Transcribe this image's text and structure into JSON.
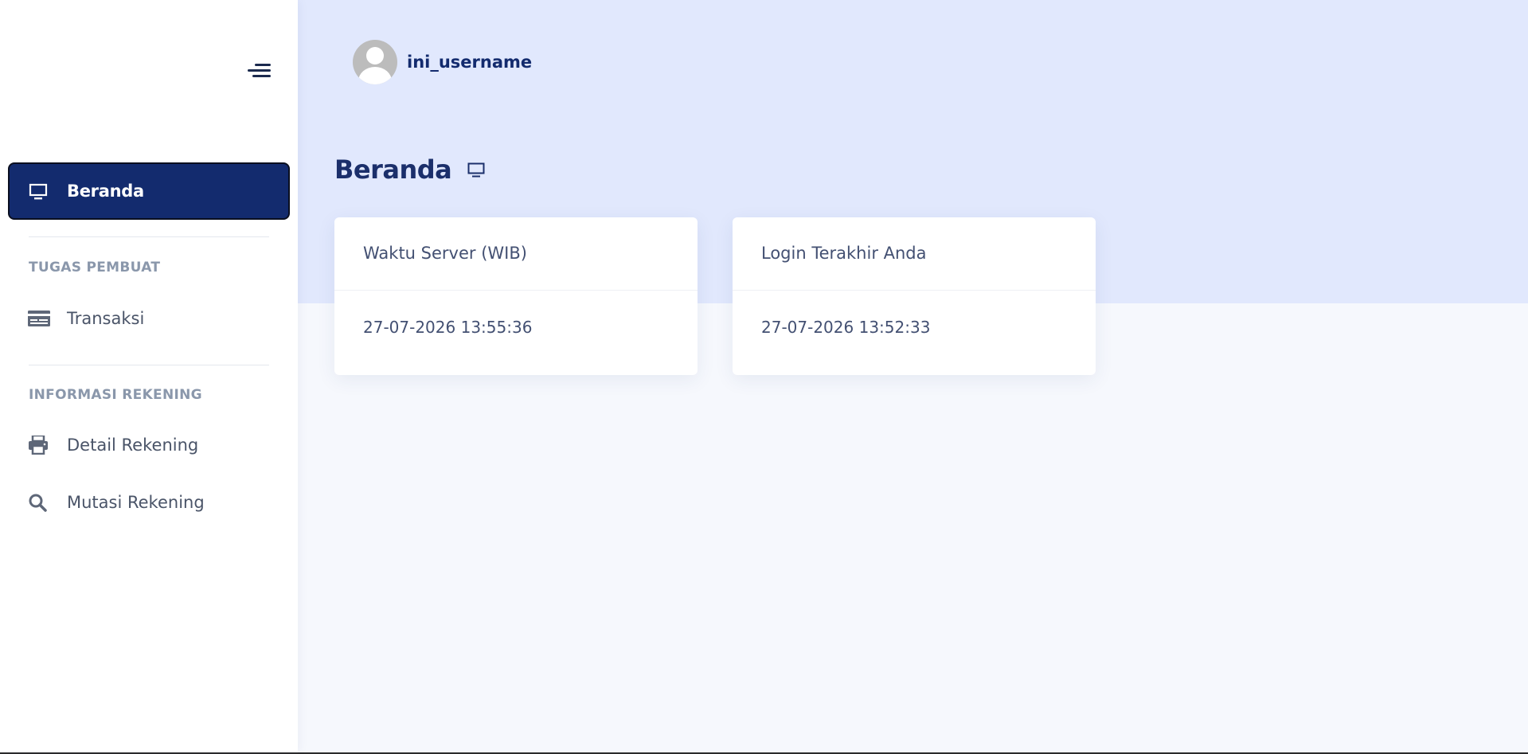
{
  "sidebar": {
    "toggle_icon": "hamburger-menu-icon",
    "active_item": {
      "label": "Beranda",
      "icon": "monitor-icon"
    },
    "sections": [
      {
        "title": "TUGAS PEMBUAT",
        "items": [
          {
            "label": "Transaksi",
            "icon": "credit-card-icon"
          }
        ]
      },
      {
        "title": "INFORMASI REKENING",
        "items": [
          {
            "label": "Detail Rekening",
            "icon": "printer-icon"
          },
          {
            "label": "Mutasi Rekening",
            "icon": "search-icon"
          }
        ]
      }
    ]
  },
  "header": {
    "username": "ini_username",
    "avatar_icon": "user-avatar-icon"
  },
  "main": {
    "title": "Beranda",
    "title_icon": "monitor-icon",
    "cards": [
      {
        "title": "Waktu Server (WIB)",
        "value": "27-07-2026 13:55:36"
      },
      {
        "title": "Login Terakhir Anda",
        "value": "27-07-2026 13:52:33"
      }
    ]
  },
  "colors": {
    "primary": "#132b6e",
    "hero_background": "#e1e8fd",
    "page_background": "#f6f8fd",
    "section_title": "#8a97ab",
    "text": "#4a5468"
  }
}
